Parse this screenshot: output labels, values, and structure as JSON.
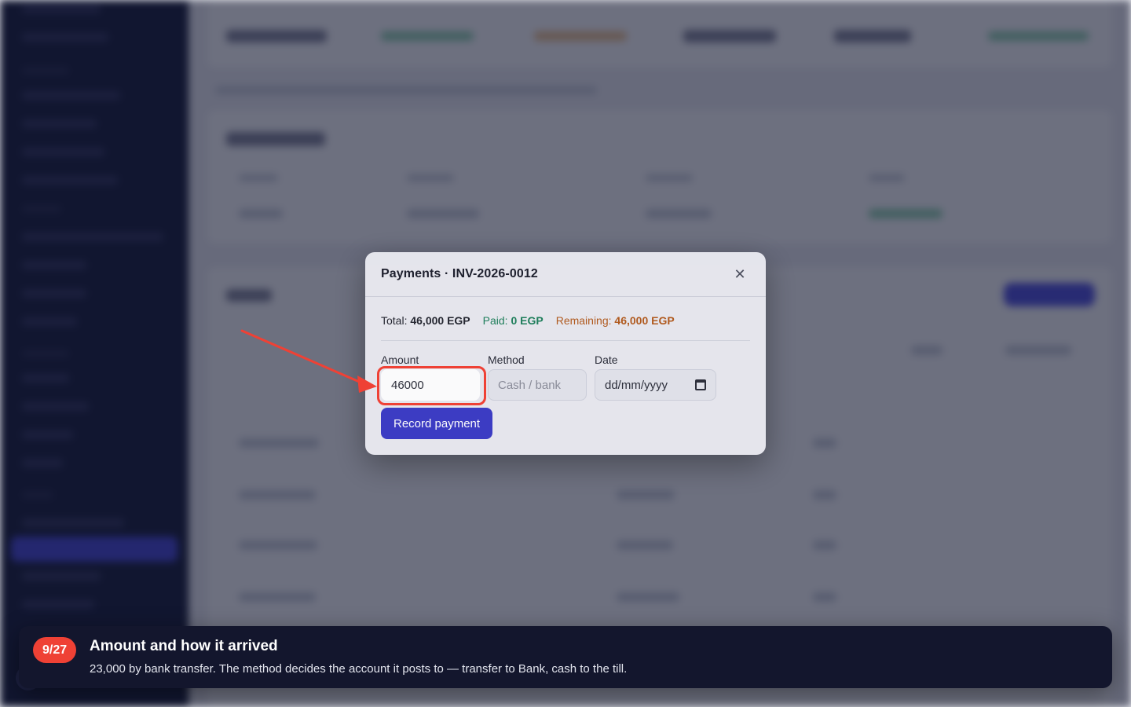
{
  "modal": {
    "title": "Payments · INV-2026-0012",
    "close_icon": "close-icon",
    "summary": {
      "total_label": "Total:",
      "total_value": "46,000 EGP",
      "paid_label": "Paid:",
      "paid_value": "0 EGP",
      "remaining_label": "Remaining:",
      "remaining_value": "46,000 EGP"
    },
    "fields": {
      "amount_label": "Amount",
      "amount_value": "46000",
      "method_label": "Method",
      "method_placeholder": "Cash / bank",
      "date_label": "Date",
      "date_placeholder": "dd/mm/yyyy"
    },
    "record_button": "Record payment"
  },
  "tour": {
    "step": "9/27",
    "title": "Amount and how it arrived",
    "body": "23,000 by bank transfer. The method decides the account it posts to — transfer to Bank, cash to the till."
  },
  "colors": {
    "accent": "#3b3bc6",
    "highlight": "#ef4135",
    "paid": "#1d7f5a",
    "remaining": "#b35a1c",
    "tour_bg": "#13162d"
  }
}
